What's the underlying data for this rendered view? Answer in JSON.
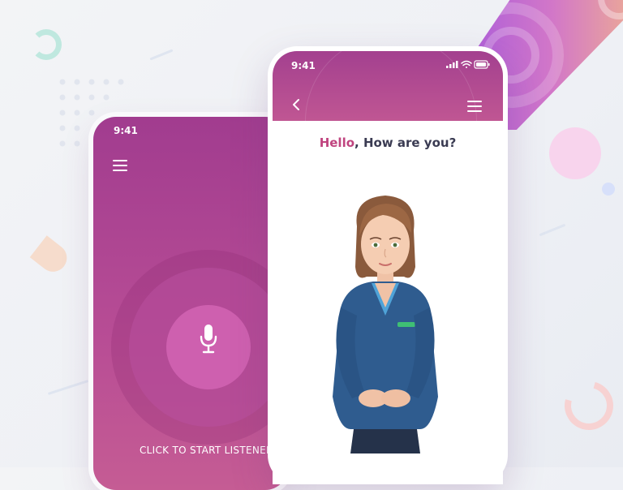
{
  "colors": {
    "primary": "#a3408f",
    "primary_light": "#c05693",
    "accent_text": "#c0447f",
    "dark_text": "#3a3b52"
  },
  "phone_listen": {
    "status_time": "9:41",
    "menu_icon": "hamburger-menu-icon",
    "mic_icon": "microphone-icon",
    "cta_label": "CLICK TO START LISTENENING"
  },
  "phone_avatar": {
    "status_time": "9:41",
    "back_icon": "chevron-left-icon",
    "menu_icon": "hamburger-menu-icon",
    "status_icons": [
      "signal-icon",
      "wifi-icon",
      "battery-icon"
    ],
    "greeting": {
      "hello": "Hello",
      "rest": ", How are you?"
    },
    "avatar": "3d-female-assistant-avatar"
  }
}
